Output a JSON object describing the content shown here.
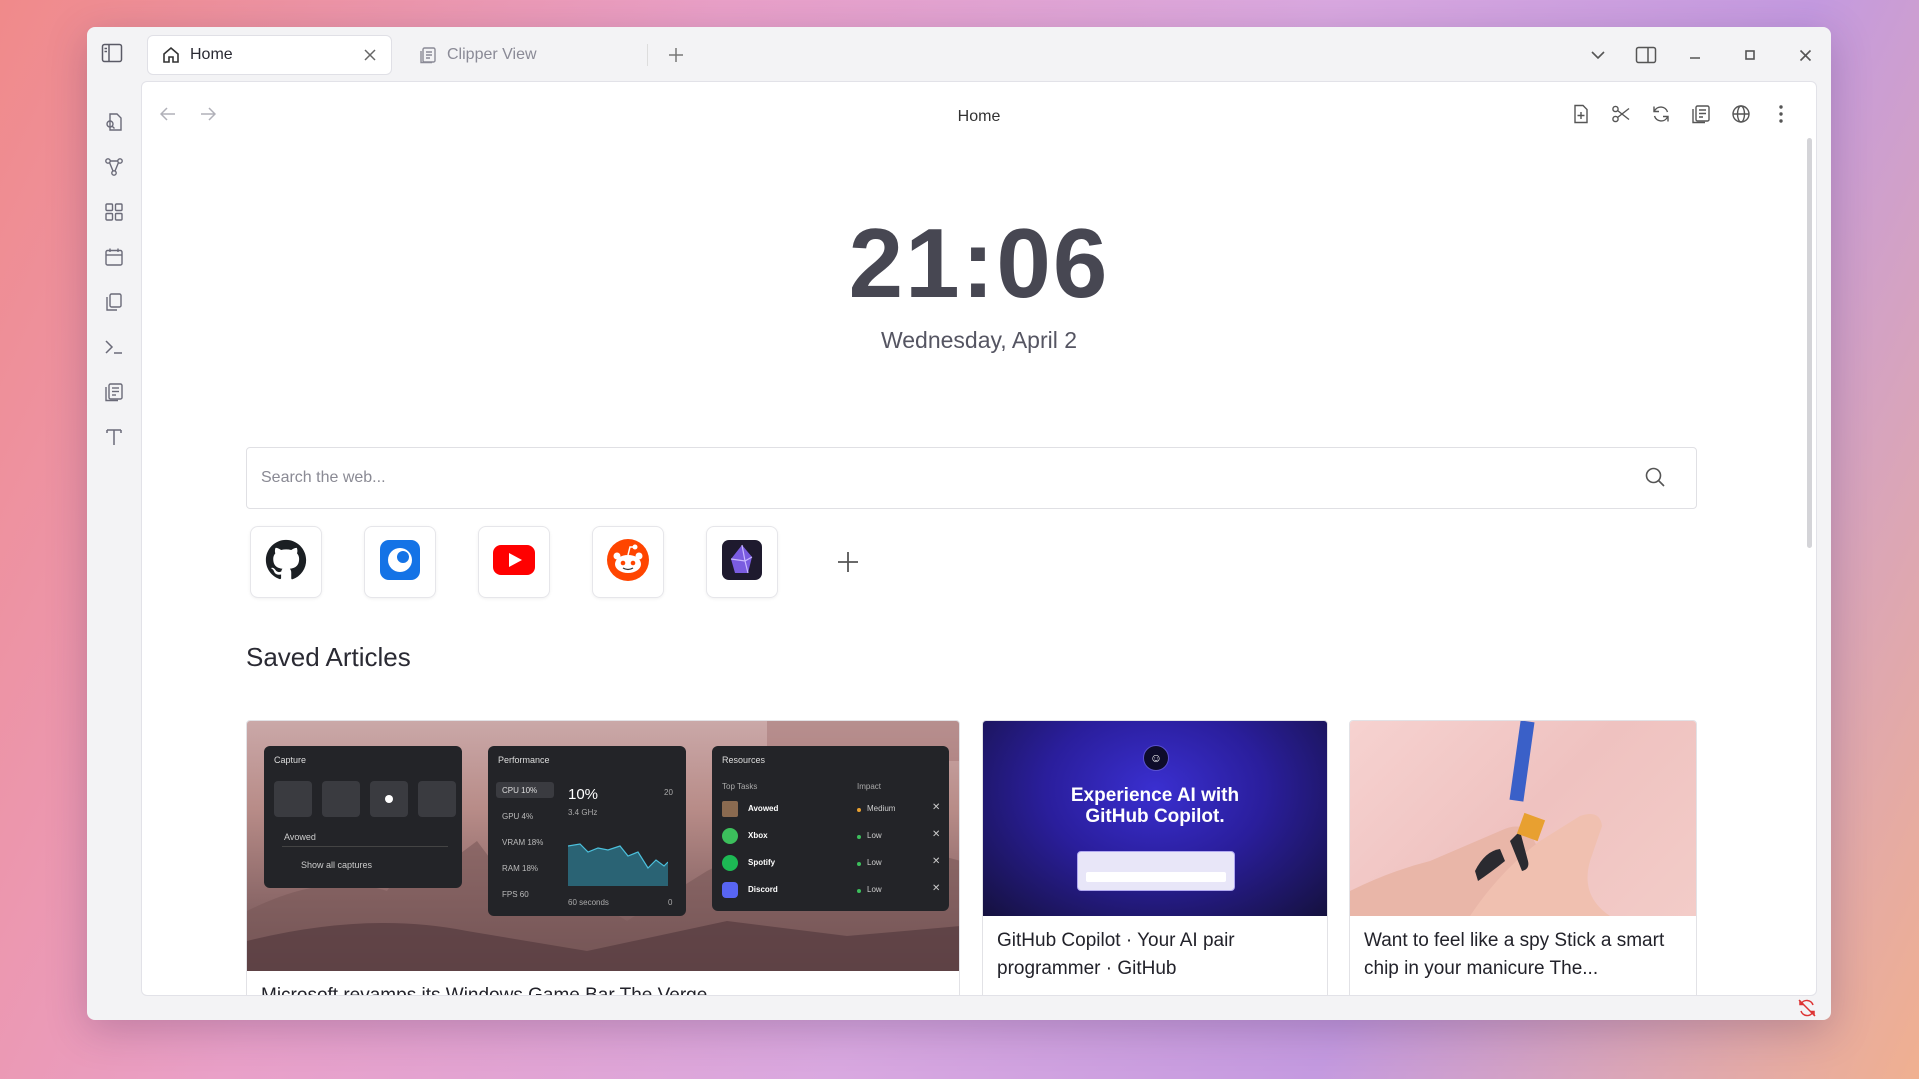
{
  "tabs": [
    {
      "label": "Home",
      "icon": "home-icon",
      "active": true
    },
    {
      "label": "Clipper View",
      "icon": "clipper-icon",
      "active": false
    }
  ],
  "page": {
    "title": "Home"
  },
  "clock": {
    "time": "21:06",
    "date": "Wednesday, April 2"
  },
  "search": {
    "placeholder": "Search the web..."
  },
  "shortcuts": [
    {
      "name": "github-shortcut",
      "icon": "github-icon"
    },
    {
      "name": "blue-app-shortcut",
      "icon": "blue-circle-app-icon"
    },
    {
      "name": "youtube-shortcut",
      "icon": "youtube-icon"
    },
    {
      "name": "reddit-shortcut",
      "icon": "reddit-icon"
    },
    {
      "name": "purple-app-shortcut",
      "icon": "purple-app-icon"
    }
  ],
  "saved": {
    "heading": "Saved Articles",
    "articles": [
      {
        "title": "Microsoft revamps its Windows Game Bar The Verge"
      },
      {
        "title": "GitHub Copilot · Your AI pair programmer · GitHub"
      },
      {
        "title": "Want to feel like a spy Stick a smart chip in your manicure The..."
      }
    ]
  },
  "gamebar": {
    "capture": {
      "title": "Capture",
      "game": "Avowed",
      "show_all": "Show all captures"
    },
    "performance": {
      "title": "Performance",
      "stats": [
        "CPU 10%",
        "GPU 4%",
        "VRAM 18%",
        "RAM 18%",
        "FPS 60"
      ],
      "big": "10%",
      "freq": "3.4 GHz",
      "max": "20",
      "window": "60 seconds",
      "min": "0"
    },
    "resources": {
      "title": "Resources",
      "col_tasks": "Top Tasks",
      "col_impact": "Impact",
      "rows": [
        {
          "name": "Avowed",
          "impact": "Medium",
          "color": "#e8a030"
        },
        {
          "name": "Xbox",
          "impact": "Low",
          "color": "#3cbf5c"
        },
        {
          "name": "Spotify",
          "impact": "Low",
          "color": "#3cbf5c"
        },
        {
          "name": "Discord",
          "impact": "Low",
          "color": "#3cbf5c"
        }
      ]
    }
  },
  "copilot": {
    "headline_1": "Experience AI with",
    "headline_2": "GitHub Copilot."
  }
}
